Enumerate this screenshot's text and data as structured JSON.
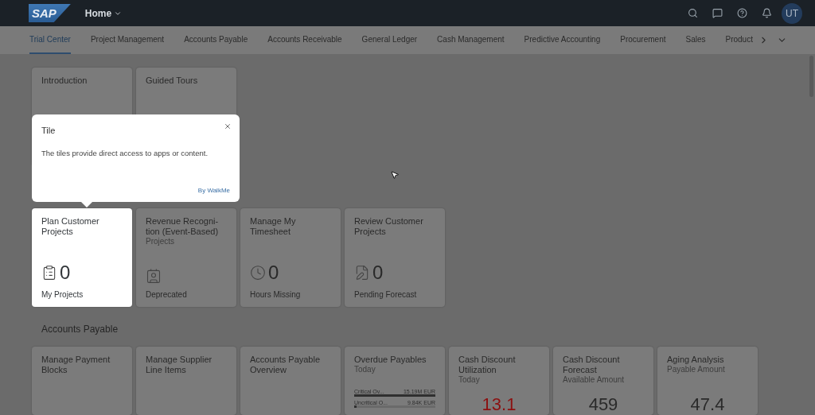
{
  "shell": {
    "logo": "SAP",
    "title": "Home",
    "avatar": "UT"
  },
  "tabs": [
    {
      "label": "Trial Center",
      "selected": true
    },
    {
      "label": "Project Management",
      "selected": false
    },
    {
      "label": "Accounts Payable",
      "selected": false
    },
    {
      "label": "Accounts Receivable",
      "selected": false
    },
    {
      "label": "General Ledger",
      "selected": false
    },
    {
      "label": "Cash Management",
      "selected": false
    },
    {
      "label": "Predictive Accounting",
      "selected": false
    },
    {
      "label": "Procurement",
      "selected": false
    },
    {
      "label": "Sales",
      "selected": false
    },
    {
      "label": "Product",
      "selected": false
    }
  ],
  "intro_tiles": [
    {
      "title": "Introduction"
    },
    {
      "title": "Guided Tours"
    }
  ],
  "popup": {
    "title": "Tile",
    "text": "The tiles provide direct access to apps or content.",
    "credit": "By WalkMe"
  },
  "trial_tiles": [
    {
      "title": "Plan Customer Projects",
      "highlighted": true,
      "number": "0",
      "footer": "My Projects"
    },
    {
      "title": "Revenue Recogni-tion (Event-Based)",
      "subtitle": "Projects",
      "highlighted": false,
      "footer": "Deprecated"
    },
    {
      "title": "Manage My Timesheet",
      "highlighted": false,
      "number": "0",
      "footer": "Hours Missing"
    },
    {
      "title": "Review Customer Projects",
      "highlighted": false,
      "number": "0",
      "footer": "Pending Forecast"
    }
  ],
  "section": {
    "title": "Accounts Payable"
  },
  "payable_tiles": [
    {
      "title": "Manage Payment Blocks",
      "kind": "plain"
    },
    {
      "title": "Manage Supplier Line Items",
      "kind": "plain"
    },
    {
      "title": "Accounts Payable Overview",
      "kind": "plain"
    },
    {
      "title": "Overdue Payables",
      "subtitle": "Today",
      "kind": "bars",
      "bars": [
        {
          "label": "Critical Ov...",
          "value": "15.19M EUR",
          "level": 1
        },
        {
          "label": "Uncritical O...",
          "value": "9.84K EUR",
          "level": 0.03
        }
      ]
    },
    {
      "title": "Cash Discount Utilization",
      "subtitle": "Today",
      "kind": "kpi",
      "number": "13.1",
      "negative": true
    },
    {
      "title": "Cash Discount Forecast",
      "subtitle": "Available Amount",
      "kind": "kpi",
      "number": "459",
      "negative": false
    },
    {
      "title": "Aging Analysis",
      "subtitle": "Payable Amount",
      "kind": "kpi",
      "number": "47.4",
      "negative": false
    }
  ]
}
